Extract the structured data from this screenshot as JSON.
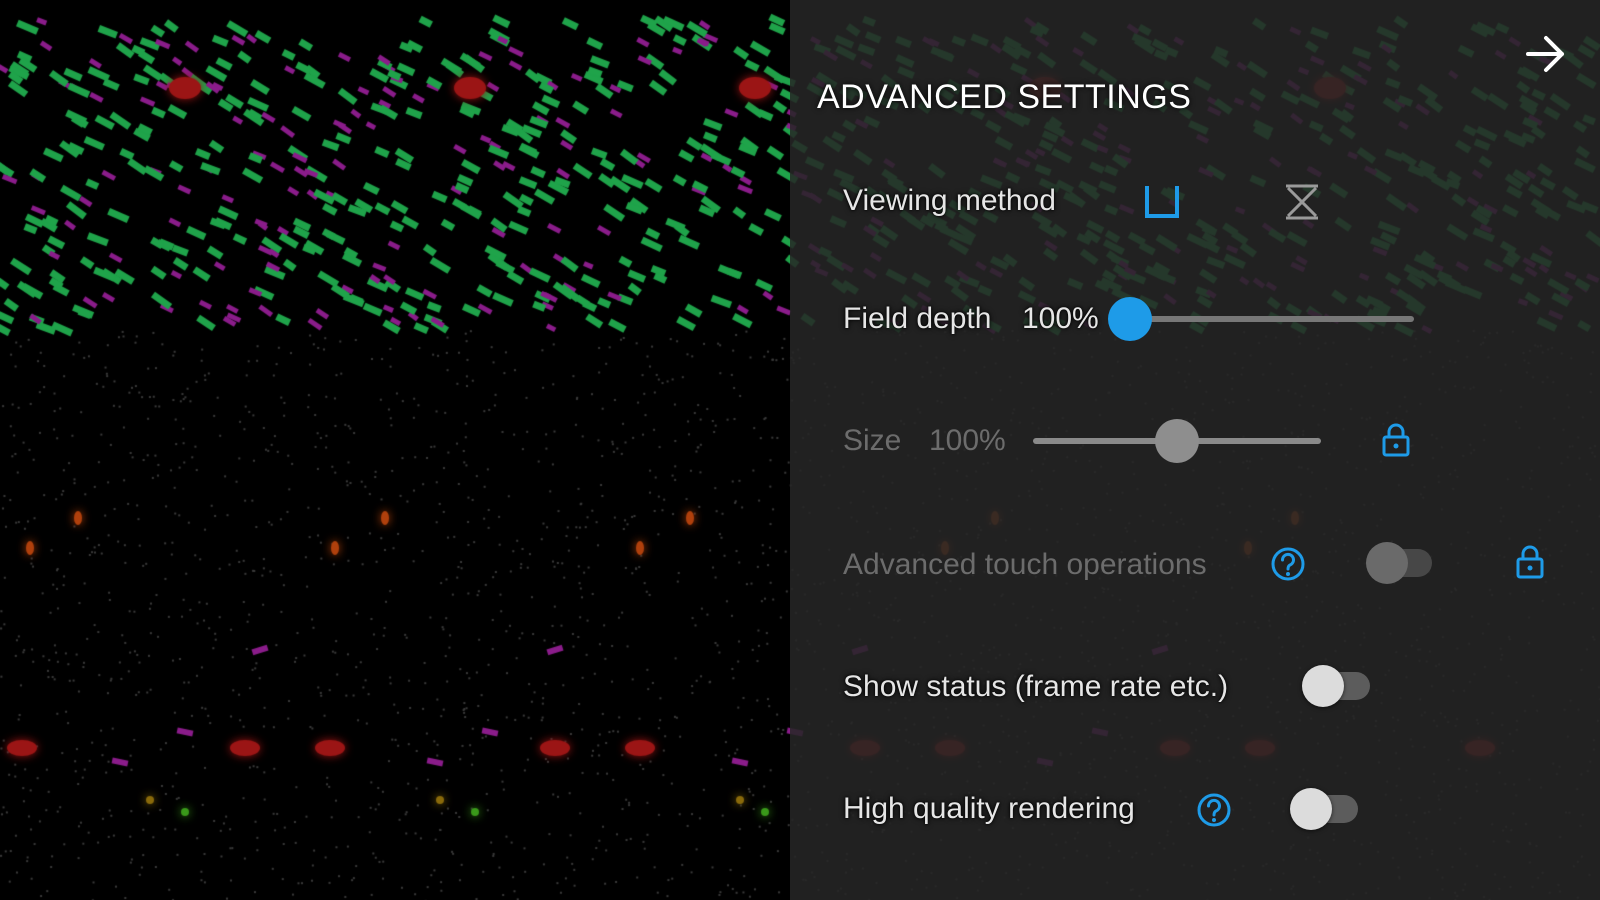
{
  "panel": {
    "title": "ADVANCED SETTINGS",
    "close_icon": "arrow-right-icon"
  },
  "colors": {
    "accent": "#1e9be8",
    "panel_bg": "#262626",
    "dim_text": "#6c6c6c",
    "green_particle": "#1fa34a",
    "magenta_particle": "#8a1c8a",
    "red_particle": "#9b1515",
    "orange_particle": "#b0400c"
  },
  "settings": {
    "viewing_method": {
      "label": "Viewing method",
      "options": [
        "parallel-view-icon",
        "cross-view-icon"
      ],
      "selected": 0
    },
    "field_depth": {
      "label": "Field depth",
      "value": "100%",
      "level": 0.0
    },
    "size": {
      "label": "Size",
      "value": "100%",
      "level": 0.5,
      "locked": true,
      "enabled": false
    },
    "advanced_touch": {
      "label": "Advanced touch operations",
      "help_icon": "help-icon",
      "enabled": false,
      "checked": false,
      "locked": true
    },
    "show_status": {
      "label": "Show status (frame rate etc.)",
      "checked": false
    },
    "high_quality": {
      "label": "High quality rendering",
      "help_icon": "help-icon",
      "checked": false
    }
  }
}
